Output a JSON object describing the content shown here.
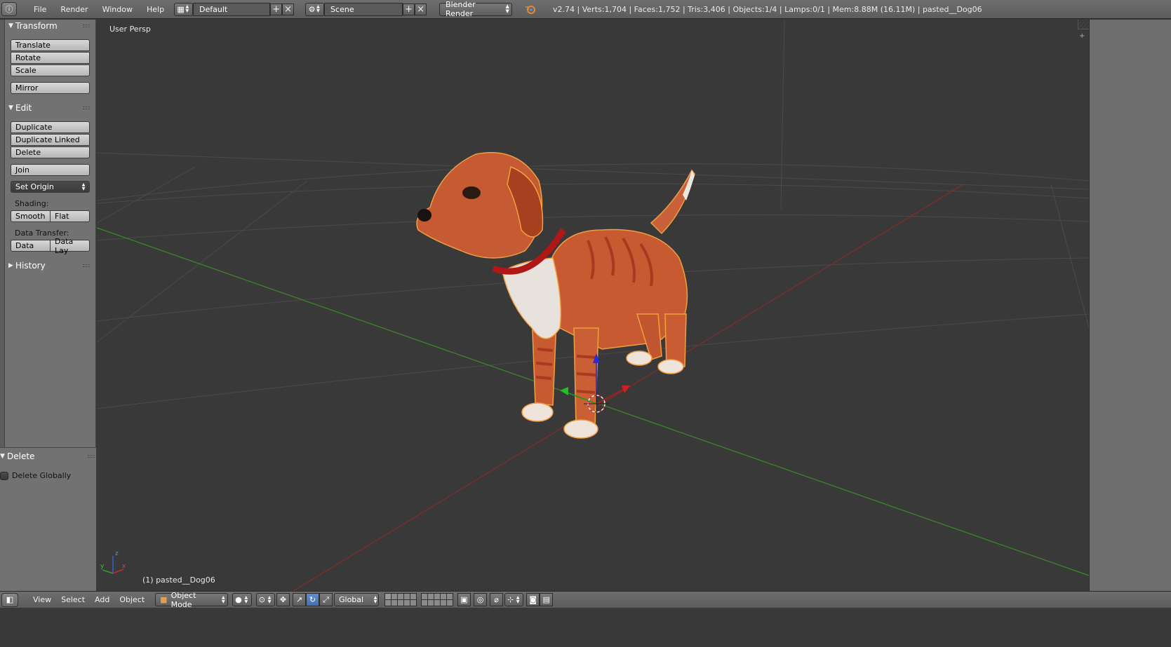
{
  "top_menu": {
    "items": [
      "File",
      "Render",
      "Window",
      "Help"
    ],
    "screen_layout": "Default",
    "scene": "Scene",
    "render_engine": "Blender Render",
    "stats": "v2.74 | Verts:1,704 | Faces:1,752 | Tris:3,406 | Objects:1/4 | Lamps:0/1 | Mem:8.88M (16.11M) | pasted__Dog06"
  },
  "toolshelf": {
    "transform": {
      "header": "Transform",
      "buttons": [
        "Translate",
        "Rotate",
        "Scale",
        "Mirror"
      ]
    },
    "edit": {
      "header": "Edit",
      "buttons": [
        "Duplicate",
        "Duplicate Linked",
        "Delete",
        "Join"
      ],
      "set_origin": "Set Origin",
      "shading_label": "Shading:",
      "shading": [
        "Smooth",
        "Flat"
      ],
      "data_transfer_label": "Data Transfer:",
      "data_transfer": [
        "Data",
        "Data Lay"
      ]
    },
    "history": {
      "header": "History"
    },
    "operator": {
      "header": "Delete",
      "checkbox_label": "Delete Globally",
      "checkbox_checked": false
    }
  },
  "viewport": {
    "view_name": "User Persp",
    "active_object": "(1) pasted__Dog06",
    "axis_labels": {
      "x": "x",
      "y": "y",
      "z": "z"
    }
  },
  "bottom_header": {
    "menus": [
      "View",
      "Select",
      "Add",
      "Object"
    ],
    "mode": "Object Mode",
    "orientation": "Global"
  },
  "colors": {
    "viewport_bg": "#393939",
    "grid": "#4a4a4a",
    "x_axis": "#8a2a2a",
    "y_axis": "#3a8a2a",
    "selection_outline": "#f0a040",
    "dog_fur": "#c85a30",
    "dog_collar": "#b01818",
    "active_blue": "#5680c2"
  },
  "icons": [
    "info-icon",
    "screen-layout-icon",
    "scene-icon",
    "blender-logo-icon",
    "add-icon",
    "close-icon",
    "3d-view-icon",
    "cube-icon",
    "solid-shading-icon",
    "pivot-icon",
    "manipulator-icon",
    "translate-icon",
    "rotate-icon",
    "scale-icon",
    "layers-icon",
    "lock-icon",
    "proportional-icon",
    "snap-icon",
    "render-icon",
    "camera-icon"
  ]
}
